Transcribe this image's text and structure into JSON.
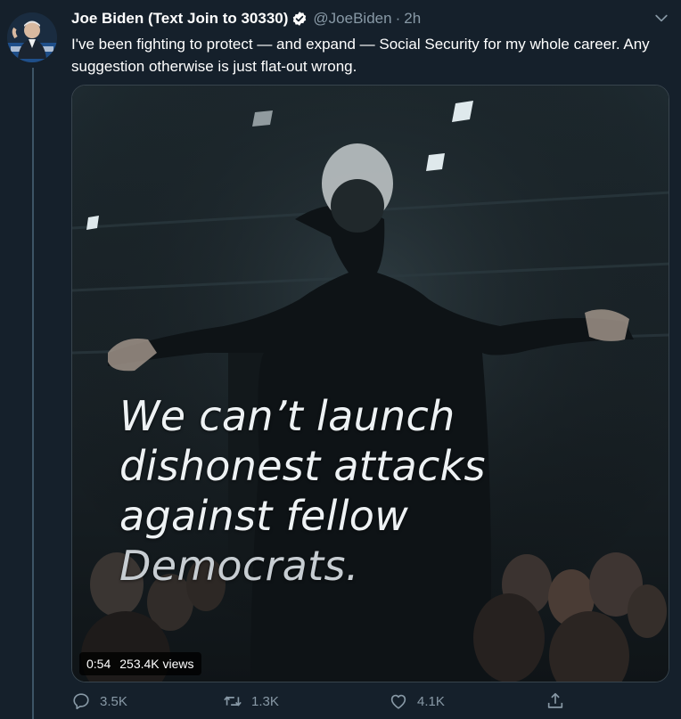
{
  "tweet": {
    "author_name": "Joe Biden (Text Join to 30330)",
    "handle": "@JoeBiden",
    "separator": "·",
    "time": "2h",
    "text": "I've been fighting to protect — and expand — Social Security for my whole career. Any suggestion otherwise is just flat-out wrong."
  },
  "media": {
    "overlay_lines": [
      "We can’t launch",
      "dishonest attacks",
      "against fellow",
      "Democrats."
    ],
    "duration": "0:54",
    "views": "253.4K views"
  },
  "actions": {
    "reply_count": "3.5K",
    "retweet_count": "1.3K",
    "like_count": "4.1K"
  },
  "icons": [
    "verified-badge-icon",
    "chevron-down-icon",
    "reply-icon",
    "retweet-icon",
    "like-icon",
    "share-icon"
  ],
  "colors": {
    "background": "#15202b",
    "secondary_text": "#8899a6",
    "primary_text": "#ffffff"
  }
}
